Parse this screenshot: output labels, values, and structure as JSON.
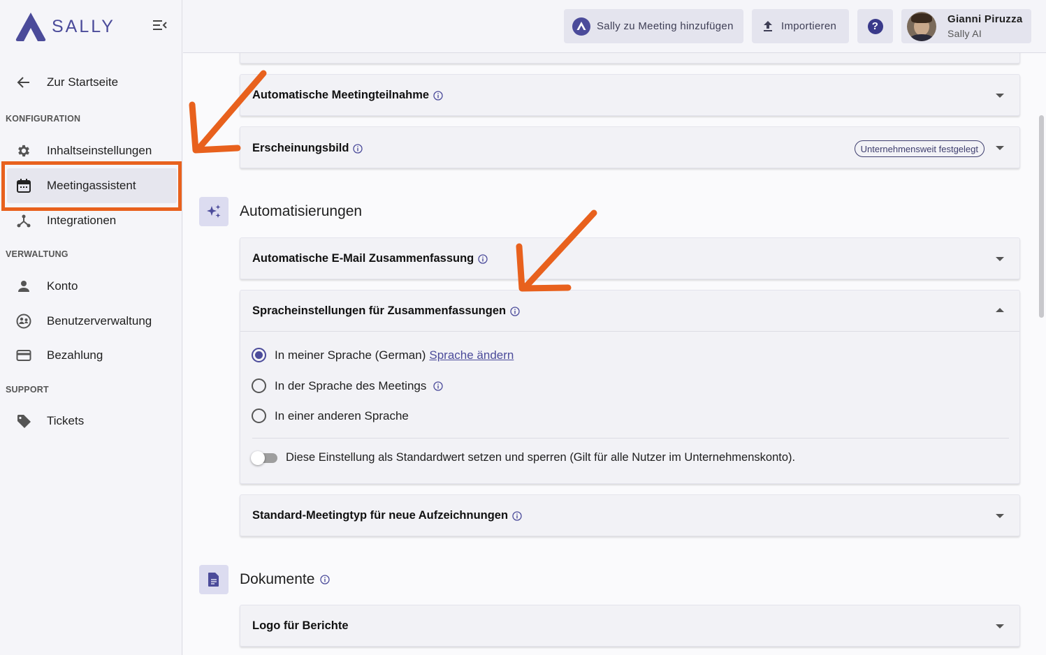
{
  "sidebar": {
    "logo_text": "SALLY",
    "back_label": "Zur Startseite",
    "sections": {
      "config": "KONFIGURATION",
      "admin": "VERWALTUNG",
      "support": "SUPPORT"
    },
    "items": [
      {
        "label": "Inhaltseinstellungen",
        "icon": "gear-icon"
      },
      {
        "label": "Meetingassistent",
        "icon": "calendar-icon",
        "active": true
      },
      {
        "label": "Integrationen",
        "icon": "integrations-icon"
      },
      {
        "label": "Konto",
        "icon": "person-icon"
      },
      {
        "label": "Benutzerverwaltung",
        "icon": "users-icon"
      },
      {
        "label": "Bezahlung",
        "icon": "credit-card-icon"
      },
      {
        "label": "Tickets",
        "icon": "tag-icon"
      }
    ]
  },
  "topbar": {
    "add_to_meeting": "Sally zu Meeting hinzufügen",
    "import": "Importieren",
    "help": "?",
    "user_name": "Gianni Piruzza",
    "user_org": "Sally AI"
  },
  "main": {
    "cards": {
      "auto_join": "Automatische Meetingteilnahme",
      "appearance": "Erscheinungsbild",
      "appearance_badge": "Unternehmensweit festgelegt",
      "email_summary": "Automatische E-Mail Zusammenfassung",
      "language_settings": "Spracheinstellungen für Zusammenfassungen",
      "default_meeting_type": "Standard-Meetingtyp für neue Aufzeichnungen",
      "report_logo": "Logo für Berichte"
    },
    "sections": {
      "automations": "Automatisierungen",
      "documents": "Dokumente"
    },
    "language_options": {
      "opt1": "In meiner Sprache (German)",
      "opt1_link": "Sprache ändern",
      "opt2": "In der Sprache des Meetings",
      "opt3": "In einer anderen Sprache",
      "selected": 1
    },
    "lock_toggle_label": "Diese Einstellung als Standardwert setzen und sperren (Gilt für alle Nutzer im Unternehmenskonto).",
    "lock_toggle_on": false
  },
  "colors": {
    "accent": "#4b4b9a",
    "annotation": "#e8611d"
  }
}
